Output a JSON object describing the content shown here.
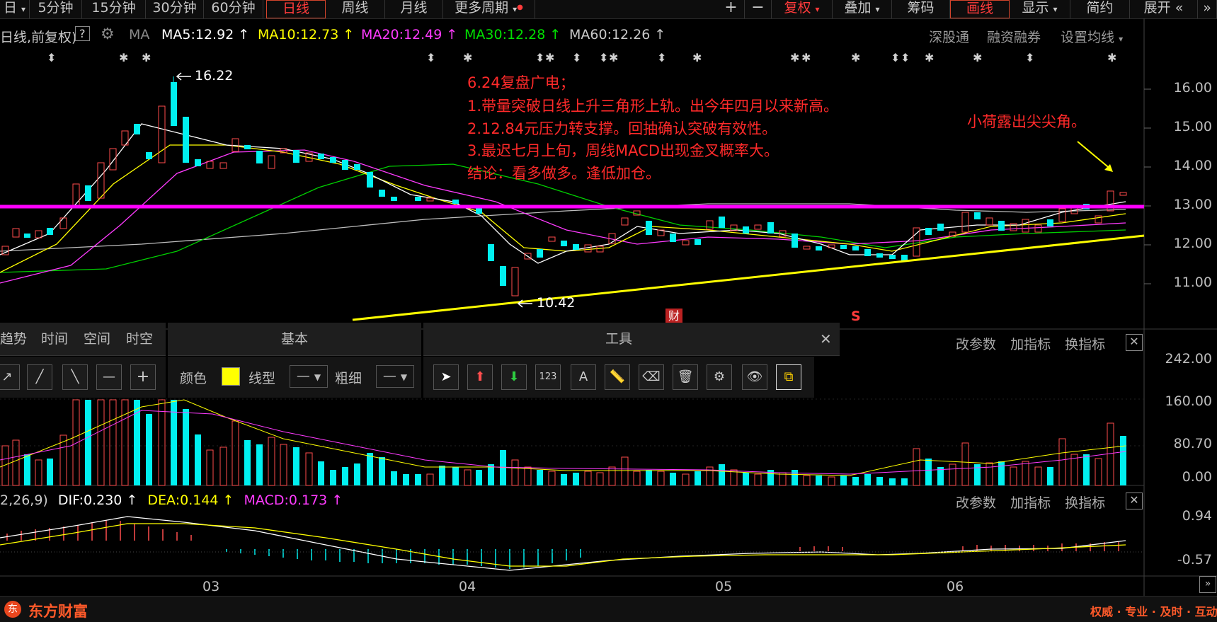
{
  "toolbar": {
    "left_tabs": [
      "日",
      "5分钟",
      "15分钟",
      "30分钟",
      "60分钟",
      "日线",
      "周线",
      "月线",
      "更多周期"
    ],
    "active_tab": "日线",
    "right_tabs": [
      "复权",
      "叠加",
      "筹码",
      "画线",
      "显示",
      "简约",
      "展开"
    ]
  },
  "ma_bar": {
    "prefix": "日线,前复权)",
    "help": "?",
    "ma_label": "MA",
    "ma5": "MA5:12.92",
    "ma10": "MA10:12.73",
    "ma20": "MA20:12.49",
    "ma30": "MA30:12.28",
    "ma60": "MA60:12.26",
    "links": [
      "深股通",
      "融资融券",
      "设置均线"
    ]
  },
  "price_axis": [
    "16.00",
    "15.00",
    "14.00",
    "13.00",
    "12.00",
    "11.00"
  ],
  "volume_axis": [
    "242.00",
    "160.00",
    "80.70",
    "0.00"
  ],
  "macd_axis": [
    "0.94",
    "-0.57"
  ],
  "x_labels": [
    "03",
    "04",
    "05",
    "06"
  ],
  "chart_notes": {
    "high": "16.22",
    "low": "10.42",
    "title": "6.24复盘广电；",
    "line1": "1.带量突破日线上升三角形上轨。出今年四月以来新高。",
    "line2": "2.12.84元压力转支撑。回抽确认突破有效性。",
    "line3": "3.最迟七月上旬，周线MACD出现金叉概率大。",
    "line4": "结论：看多做多。逢低加仓。",
    "side": "小荷露出尖尖角。",
    "cai_badge": "财",
    "s_badge": "S"
  },
  "indicator_bar": {
    "links": [
      "改参数",
      "加指标",
      "换指标"
    ]
  },
  "macd_bar": {
    "params": "2,26,9)",
    "dif": "DIF:0.230",
    "dea": "DEA:0.144",
    "macd": "MACD:0.173"
  },
  "draw_panel": {
    "tabs": [
      "趋势",
      "时间",
      "空间",
      "时空"
    ],
    "basic_title": "基本",
    "color_label": "颜色",
    "line_type_label": "线型",
    "thickness_label": "粗细",
    "tools_title": "工具",
    "tool_number_glyph": "123"
  },
  "footer": {
    "brand": "东方财富",
    "slogan": "权威 · 专业 · 及时 · 互动"
  },
  "colors": {
    "up": "#ff4d4d",
    "down": "#00f0f0",
    "ma5": "#ffffff",
    "ma10": "#ffff00",
    "ma20": "#ff3bff",
    "ma30": "#00e000",
    "ma60": "#c8c8c8",
    "accent_red": "#ff2a2a",
    "magenta_line": "#ff00ff",
    "trend_line": "#ffff00"
  }
}
